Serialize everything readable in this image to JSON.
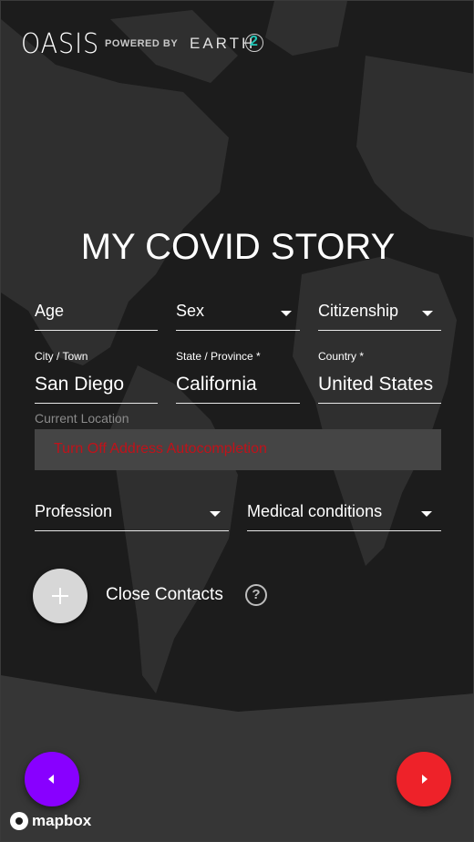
{
  "header": {
    "brand": "OASIS",
    "powered_by": "POWERED BY",
    "partner": "EARTH",
    "partner_suffix": "2"
  },
  "title": "MY COVID STORY",
  "fields": {
    "age": {
      "label": "Age"
    },
    "sex": {
      "label": "Sex"
    },
    "citizenship": {
      "label": "Citizenship"
    },
    "city": {
      "label": "City / Town",
      "value": "San Diego"
    },
    "state": {
      "label": "State / Province *",
      "value": "California"
    },
    "country": {
      "label": "Country *",
      "value": "United States"
    },
    "profession": {
      "label": "Profession"
    },
    "medical": {
      "label": "Medical conditions"
    }
  },
  "location": {
    "label": "Current Location",
    "autocomplete_link": "Turn Off Address Autocompletion"
  },
  "contacts": {
    "label": "Close Contacts",
    "help": "?"
  },
  "nav": {
    "back_color": "#8800ff",
    "next_color": "#ee2229"
  },
  "attribution": {
    "text": "mapbox"
  },
  "colors": {
    "link_red": "#c0121a",
    "accent_teal": "#22c8b8"
  },
  "icons": [
    "plus-icon",
    "help-icon",
    "chevron-left-icon",
    "chevron-right-icon",
    "mapbox-logo-icon",
    "caret-down-icon"
  ]
}
